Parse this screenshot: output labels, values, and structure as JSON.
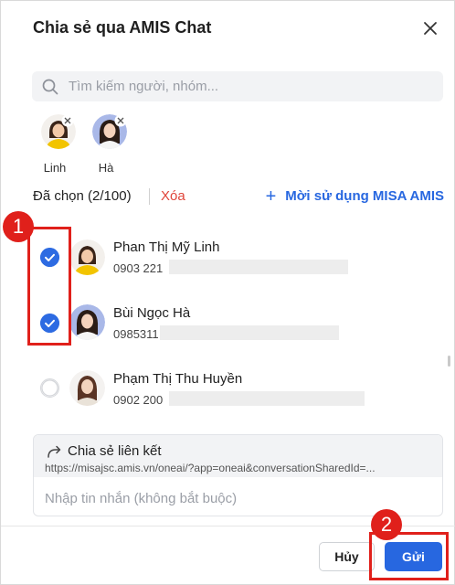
{
  "dialog": {
    "title": "Chia sẻ qua AMIS Chat",
    "search_placeholder": "Tìm kiếm người, nhóm..."
  },
  "selected_chips": [
    {
      "name": "Linh"
    },
    {
      "name": "Hà"
    }
  ],
  "selection": {
    "count_label": "Đã chọn (2/100)",
    "clear_label": "Xóa",
    "invite_label": "Mời sử dụng MISA AMIS"
  },
  "contacts": [
    {
      "name": "Phan Thị Mỹ Linh",
      "phone": "0903 221",
      "checked": true
    },
    {
      "name": "Bùi Ngọc Hà",
      "phone": "0985311",
      "checked": true
    },
    {
      "name": "Phạm Thị Thu Huyền",
      "phone": "0902 200",
      "checked": false
    }
  ],
  "share": {
    "title": "Chia sẻ liên kết",
    "url": "https://misajsc.amis.vn/oneai/?app=oneai&conversationSharedId=...",
    "message_placeholder": "Nhập tin nhắn (không bắt buộc)"
  },
  "footer": {
    "cancel_label": "Hủy",
    "send_label": "Gửi"
  },
  "annotations": {
    "step1": "1",
    "step2": "2",
    "color": "#e0201b"
  },
  "colors": {
    "accent": "#2767e0",
    "danger": "#e0453a"
  }
}
